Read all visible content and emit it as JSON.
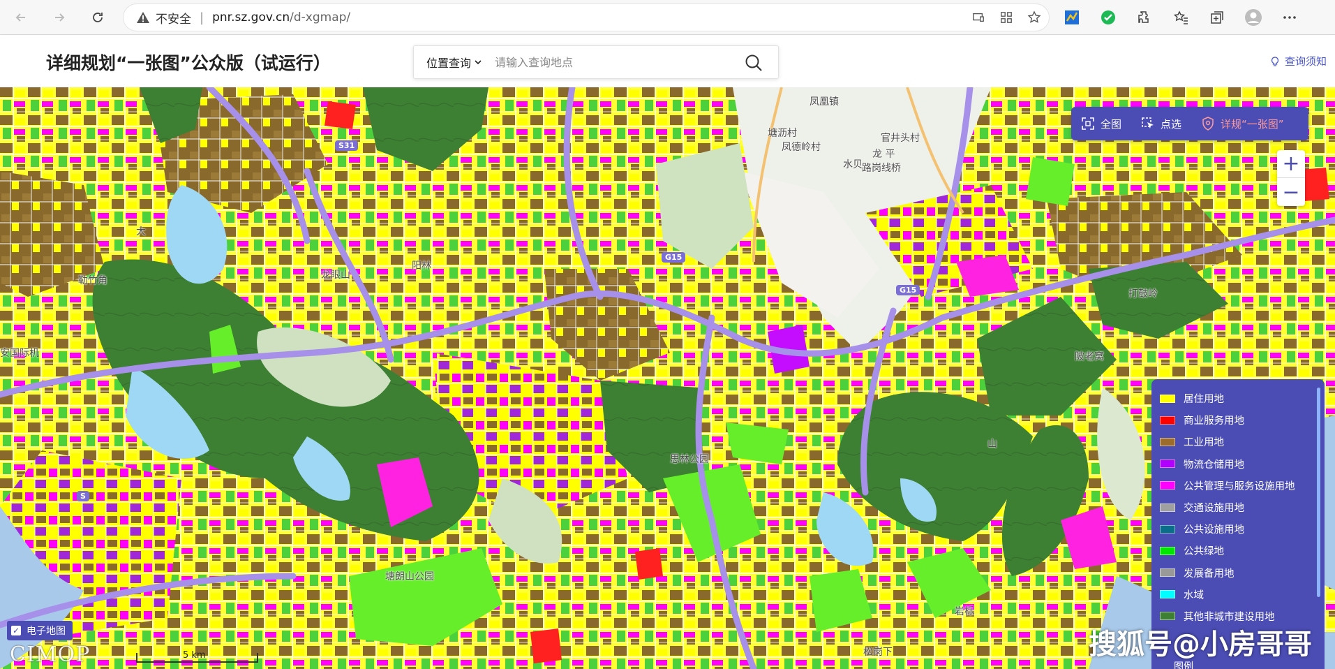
{
  "browser": {
    "security_label": "不安全",
    "url_host": "pnr.sz.gov.cn",
    "url_path": "/d-xgmap/"
  },
  "header": {
    "title": "详细规划“一张图”公众版（试运行）",
    "search_type": "位置查询",
    "search_placeholder": "请输入查询地点",
    "help_label": "查询须知"
  },
  "toolbar": {
    "full_label": "全图",
    "select_label": "点选",
    "detail_label": "详规“一张图”"
  },
  "zoom": {
    "in": "+",
    "out": "−"
  },
  "legend": {
    "items": [
      {
        "label": "居住用地",
        "color": "#ffff00"
      },
      {
        "label": "商业服务用地",
        "color": "#ff0000"
      },
      {
        "label": "工业用地",
        "color": "#9c6c2c"
      },
      {
        "label": "物流仓储用地",
        "color": "#b200ff"
      },
      {
        "label": "公共管理与服务设施用地",
        "color": "#ff00ff"
      },
      {
        "label": "交通设施用地",
        "color": "#a0a0a0"
      },
      {
        "label": "公共设施用地",
        "color": "#0a6d8a"
      },
      {
        "label": "公共绿地",
        "color": "#00e600"
      },
      {
        "label": "发展备用地",
        "color": "#999999"
      },
      {
        "label": "水域",
        "color": "#00ffff"
      },
      {
        "label": "其他非城市建设用地",
        "color": "#3d7f33"
      }
    ],
    "footer": "图例"
  },
  "layer_toggle": {
    "label": "电子地图",
    "checked": true
  },
  "logo": "CIMOP",
  "scale": "5 km",
  "watermark": "搜狐号@小房哥哥",
  "places": {
    "fenghuang": "凤凰镇",
    "tangli": "塘沥村",
    "fengde": "凤德岭村",
    "longping": "龙 平",
    "lugang": "路岗线桥",
    "guanjing": "官井头村",
    "shuibei": "水贝",
    "longyan": "龙眼山",
    "lezhujiao": "勒竹角",
    "airport": "安国际机",
    "meiwan": "塘朗山公园",
    "silin": "思林公园",
    "dafenzhan": "打鼓岭",
    "shikeng": "岩栎",
    "songgang": "松岗下",
    "yangmei": "阳林",
    "zhuling": "陂老窝",
    "dashu": "大",
    "shan": "山"
  },
  "highways": {
    "s31": "S31",
    "g15a": "G15",
    "g15b": "G15",
    "s": "S"
  }
}
